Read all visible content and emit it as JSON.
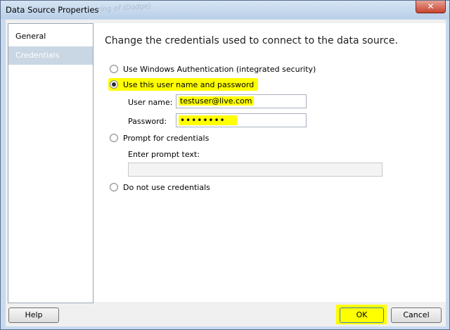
{
  "window": {
    "title": "Data Source Properties",
    "background_text": "ring of (Dodge)",
    "close_glyph": "✕"
  },
  "nav": {
    "items": [
      {
        "label": "General",
        "selected": false
      },
      {
        "label": "Credentials",
        "selected": true
      }
    ]
  },
  "main": {
    "heading": "Change the credentials used to connect to the data source.",
    "options": {
      "windows_auth": {
        "label": "Use Windows Authentication (integrated security)",
        "checked": false
      },
      "user_password": {
        "label": "Use this user name and password",
        "checked": true
      },
      "prompt": {
        "label": "Prompt for credentials",
        "checked": false
      },
      "none": {
        "label": "Do not use credentials",
        "checked": false
      }
    },
    "username": {
      "label": "User name:",
      "value": "testuser@live.com"
    },
    "password": {
      "label": "Password:",
      "value": "••••••••"
    },
    "prompt_text": {
      "label": "Enter prompt text:",
      "value": ""
    }
  },
  "footer": {
    "help_label": "Help",
    "ok_label": "OK",
    "cancel_label": "Cancel"
  },
  "colors": {
    "highlight": "#ffff00",
    "titlebar": "#c8daef",
    "selected_nav": "#c9d6e3"
  }
}
